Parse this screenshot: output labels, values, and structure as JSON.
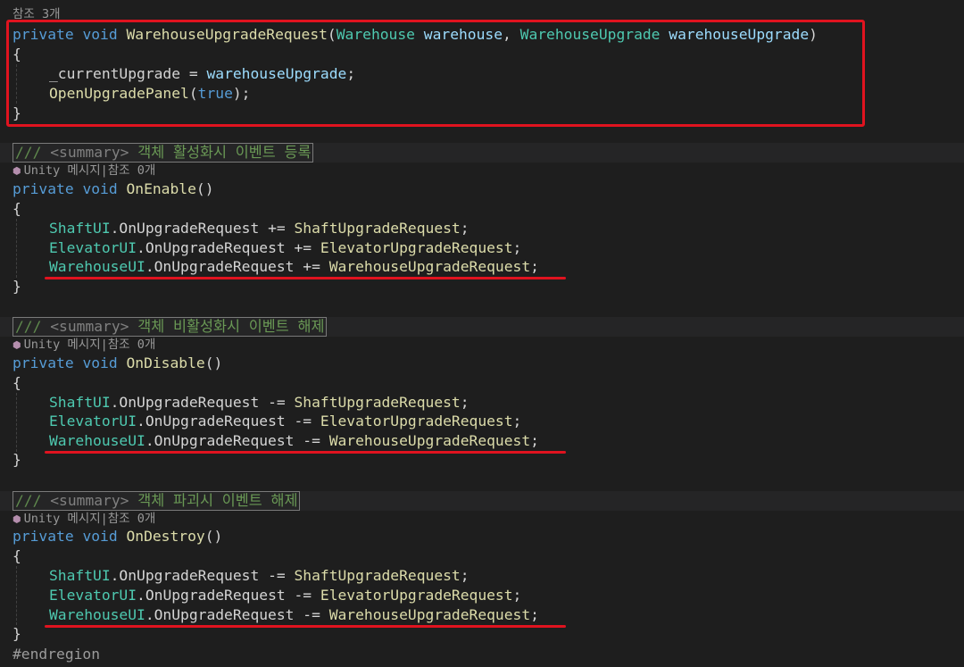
{
  "colors": {
    "background": "#1e1e1e",
    "keyword": "#569cd6",
    "method": "#dcdcaa",
    "type": "#4ec9b0",
    "parameter": "#9cdcfe",
    "comment": "#6a9955",
    "annotation": "#e0131f"
  },
  "lens_top": "참조 3개",
  "method1": {
    "kw1": "private",
    "kw2": "void",
    "name": "WarehouseUpgradeRequest",
    "open": "(",
    "type1": "Warehouse",
    "param1": "warehouse",
    "comma": ",",
    "type2": "WarehouseUpgrade",
    "param2": "warehouseUpgrade",
    "close": ")",
    "brace_open": "{",
    "line1_field": "_currentUpgrade",
    "line1_op": " = ",
    "line1_value": "warehouseUpgrade",
    "line1_end": ";",
    "line2_call": "OpenUpgradePanel",
    "line2_open": "(",
    "line2_arg": "true",
    "line2_end": ");",
    "brace_close": "}"
  },
  "block_enable": {
    "doc_slash": "///",
    "doc_tag": "<summary>",
    "doc_text": "객체 활성화시 이벤트 등록",
    "lens_icon": "unity-cube-icon",
    "lens_text": "Unity 메시지|참조 0개",
    "kw1": "private",
    "kw2": "void",
    "name": "OnEnable",
    "parens": "()",
    "brace_open": "{",
    "rows": [
      {
        "type": "ShaftUI",
        "rest": ".OnUpgradeRequest += ",
        "handler": "ShaftUpgradeRequest",
        "end": ";"
      },
      {
        "type": "ElevatorUI",
        "rest": ".OnUpgradeRequest += ",
        "handler": "ElevatorUpgradeRequest",
        "end": ";"
      },
      {
        "type": "WarehouseUI",
        "rest": ".OnUpgradeRequest += ",
        "handler": "WarehouseUpgradeRequest",
        "end": ";"
      }
    ],
    "brace_close": "}"
  },
  "block_disable": {
    "doc_slash": "///",
    "doc_tag": "<summary>",
    "doc_text": "객체 비활성화시 이벤트 해제",
    "lens_icon": "unity-cube-icon",
    "lens_text": "Unity 메시지|참조 0개",
    "kw1": "private",
    "kw2": "void",
    "name": "OnDisable",
    "parens": "()",
    "brace_open": "{",
    "rows": [
      {
        "type": "ShaftUI",
        "rest": ".OnUpgradeRequest -= ",
        "handler": "ShaftUpgradeRequest",
        "end": ";"
      },
      {
        "type": "ElevatorUI",
        "rest": ".OnUpgradeRequest -= ",
        "handler": "ElevatorUpgradeRequest",
        "end": ";"
      },
      {
        "type": "WarehouseUI",
        "rest": ".OnUpgradeRequest -= ",
        "handler": "WarehouseUpgradeRequest",
        "end": ";"
      }
    ],
    "brace_close": "}"
  },
  "block_destroy": {
    "doc_slash": "///",
    "doc_tag": "<summary>",
    "doc_text": "객체 파괴시 이벤트 해제",
    "lens_icon": "unity-cube-icon",
    "lens_text": "Unity 메시지|참조 0개",
    "kw1": "private",
    "kw2": "void",
    "name": "OnDestroy",
    "parens": "()",
    "brace_open": "{",
    "rows": [
      {
        "type": "ShaftUI",
        "rest": ".OnUpgradeRequest -= ",
        "handler": "ShaftUpgradeRequest",
        "end": ";"
      },
      {
        "type": "ElevatorUI",
        "rest": ".OnUpgradeRequest -= ",
        "handler": "ElevatorUpgradeRequest",
        "end": ";"
      },
      {
        "type": "WarehouseUI",
        "rest": ".OnUpgradeRequest -= ",
        "handler": "WarehouseUpgradeRequest",
        "end": ";"
      }
    ],
    "brace_close": "}"
  },
  "endregion": "#endregion"
}
